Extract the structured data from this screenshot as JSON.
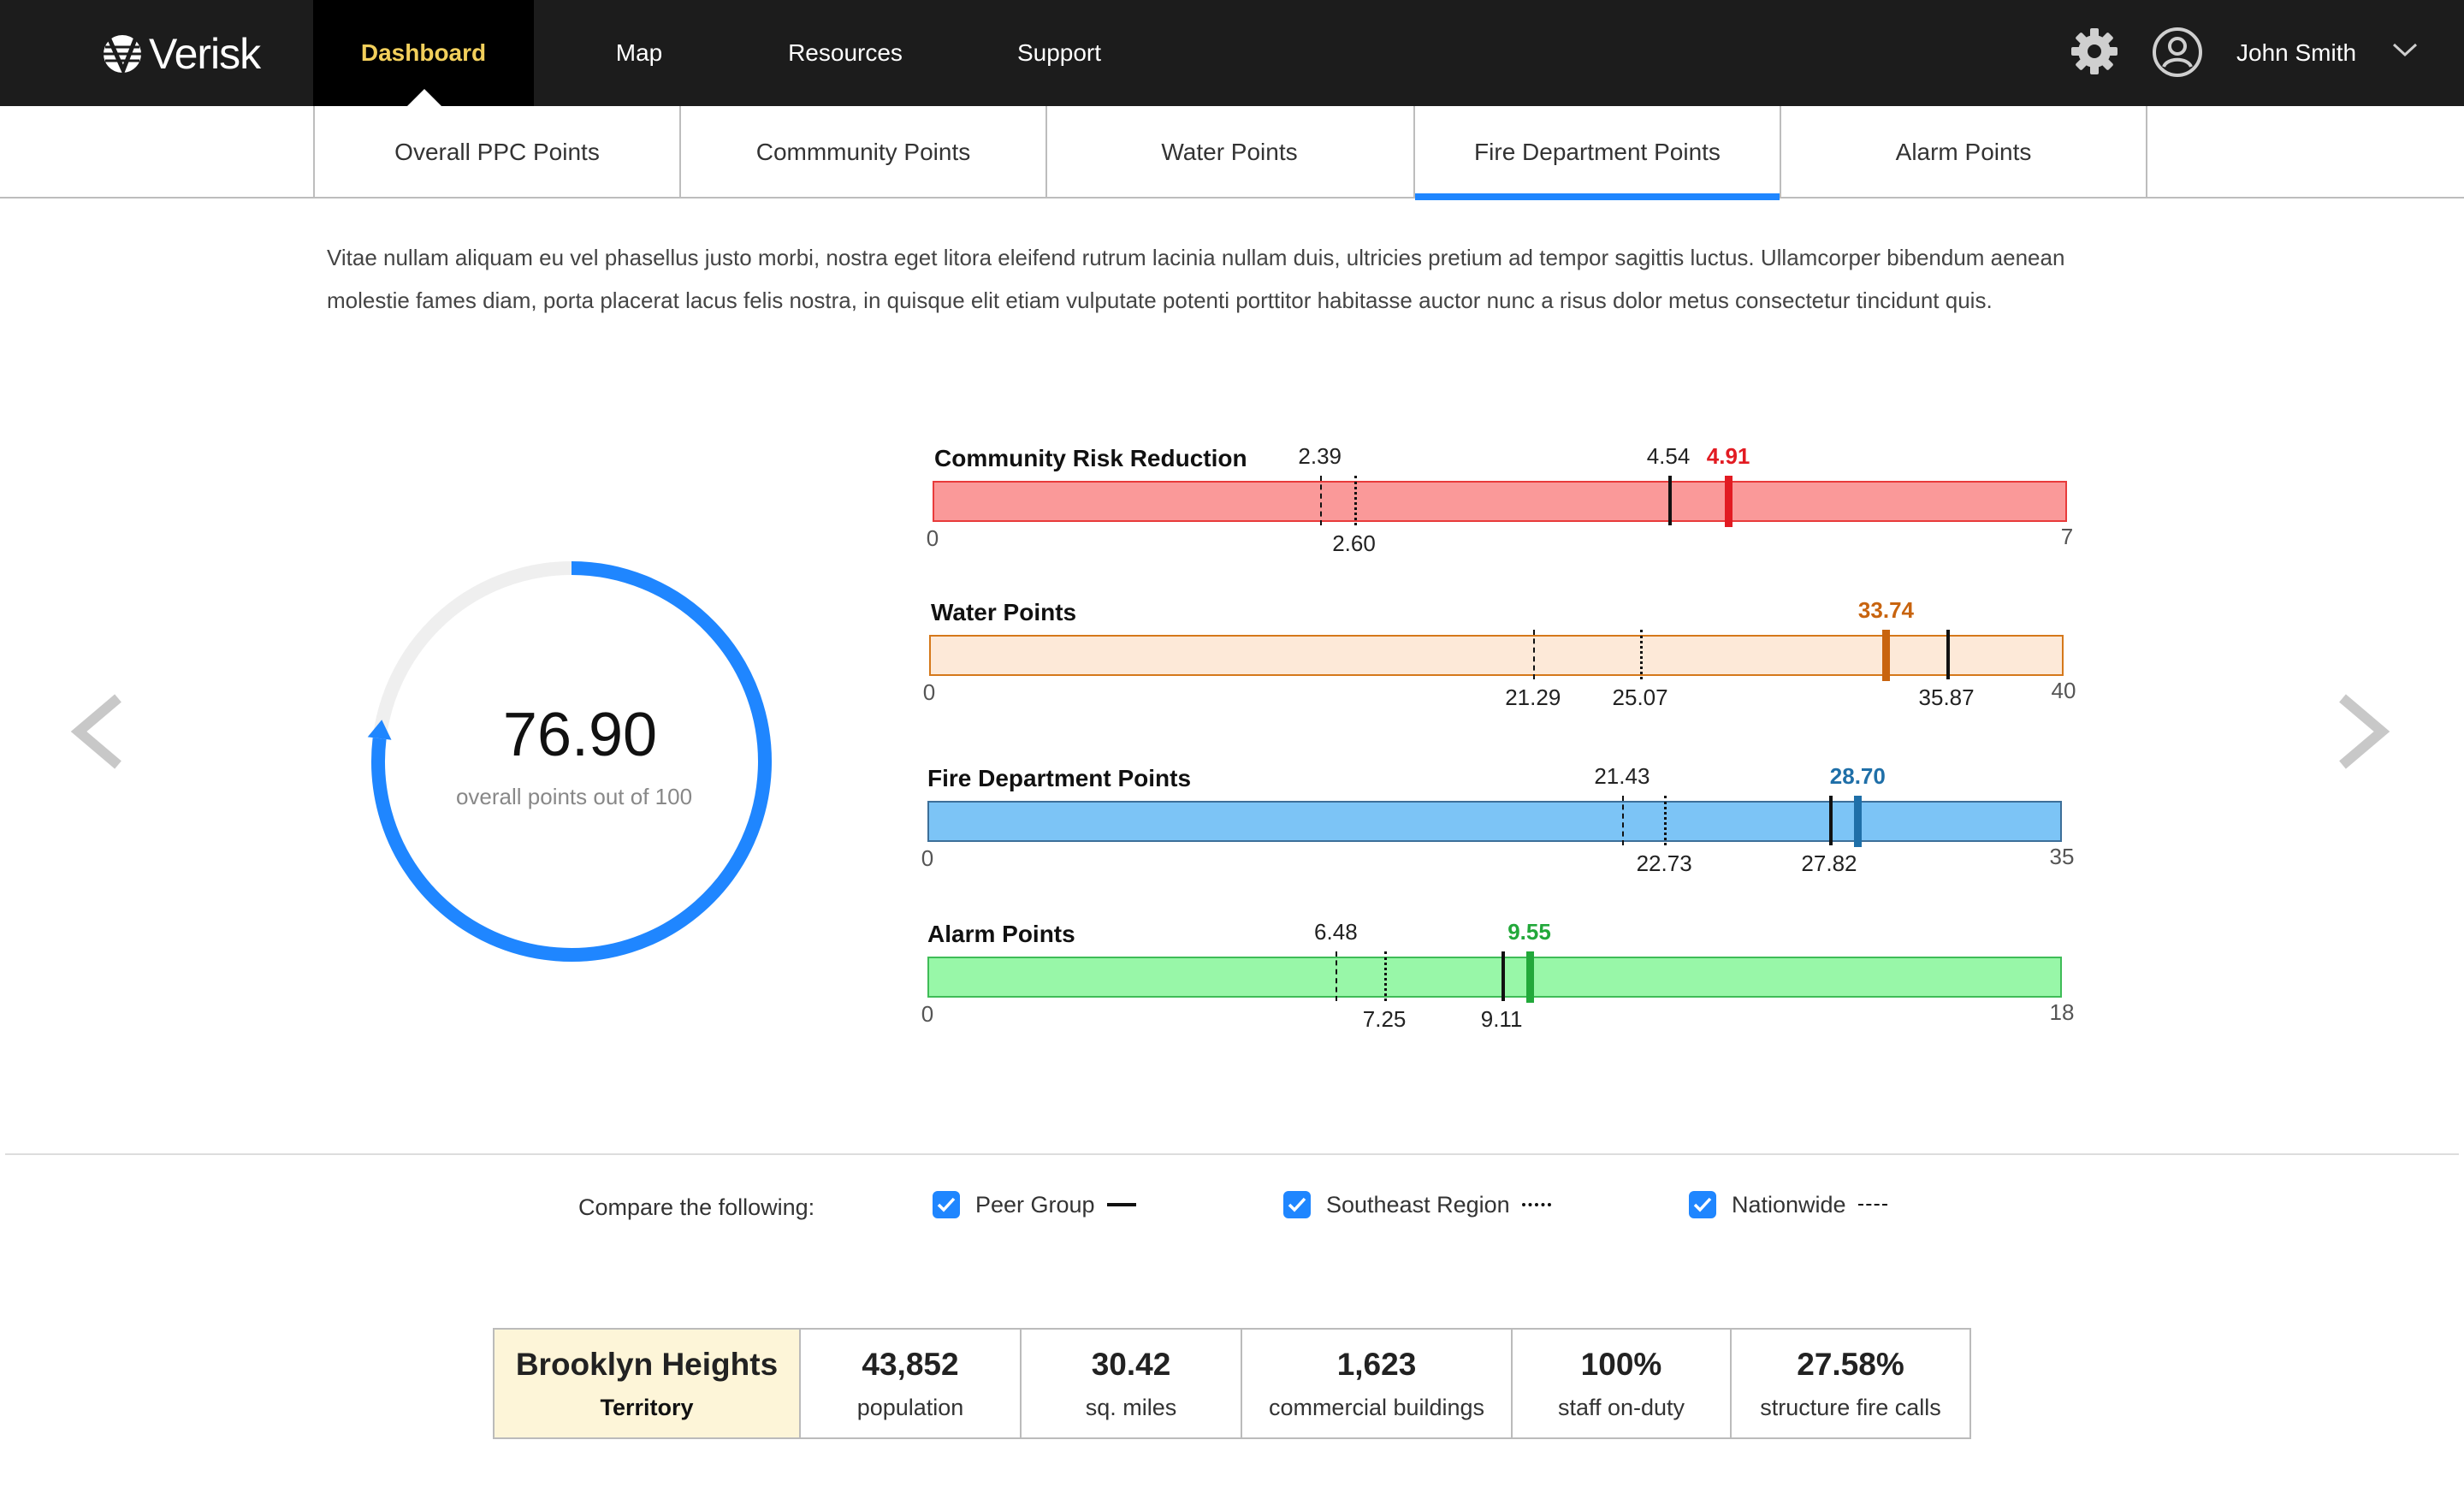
{
  "brand": {
    "name": "Verisk"
  },
  "nav": {
    "items": [
      {
        "label": "Dashboard",
        "active": true
      },
      {
        "label": "Map"
      },
      {
        "label": "Resources"
      },
      {
        "label": "Support"
      }
    ],
    "user": {
      "name": "John Smith"
    },
    "icons": {
      "settings": "gear-icon",
      "user": "user-circle-icon",
      "menu": "chevron-down-icon"
    },
    "active_color": "#f2cf5b"
  },
  "tabs": [
    {
      "label": "Overall PPC Points"
    },
    {
      "label": "Commmunity Points"
    },
    {
      "label": "Water Points"
    },
    {
      "label": "Fire Department Points",
      "active": true
    },
    {
      "label": "Alarm Points"
    }
  ],
  "description": "Vitae nullam aliquam eu vel phasellus justo morbi, nostra eget litora eleifend rutrum lacinia nullam duis, ultricies pretium ad tempor sagittis luctus.  Ullamcorper bibendum aenean molestie fames diam, porta placerat lacus felis nostra, in quisque elit etiam vulputate potenti porttitor habitasse auctor nunc a risus dolor metus consectetur tincidunt quis.",
  "gauge": {
    "value": "76.90",
    "caption": "overall points out of 100",
    "fraction": 0.769,
    "color": "#1f86ff"
  },
  "chart_data": {
    "type": "bar",
    "series": [
      {
        "name": "Community Risk Reduction",
        "min": 0,
        "max": 7,
        "value": 4.91,
        "peer_group": 4.54,
        "southeast_region": 2.6,
        "nationwide": 2.39,
        "labels": {
          "min": "0",
          "max": "7",
          "value": "4.91",
          "peer_group": "4.54",
          "southeast_region": "2.60",
          "nationwide": "2.39"
        },
        "fill": "#fa9999",
        "border": "#e83b3b",
        "accent": "#e21b22"
      },
      {
        "name": "Water Points",
        "min": 0,
        "max": 40,
        "value": 33.74,
        "peer_group": 35.87,
        "southeast_region": 25.07,
        "nationwide": 21.29,
        "labels": {
          "min": "0",
          "max": "40",
          "value": "33.74",
          "peer_group": "35.87",
          "southeast_region": "25.07",
          "nationwide": "21.29"
        },
        "fill": "#fde9d8",
        "border": "#d5781a",
        "accent": "#c8640f"
      },
      {
        "name": "Fire Department Points",
        "min": 0,
        "max": 35,
        "value": 28.7,
        "peer_group": 27.82,
        "southeast_region": 22.73,
        "nationwide": 21.43,
        "labels": {
          "min": "0",
          "max": "35",
          "value": "28.70",
          "peer_group": "27.82",
          "southeast_region": "22.73",
          "nationwide": "21.43"
        },
        "fill": "#7cc4f6",
        "border": "#3d6f99",
        "accent": "#1f6fa8"
      },
      {
        "name": "Alarm Points",
        "min": 0,
        "max": 18,
        "value": 9.55,
        "peer_group": 9.11,
        "southeast_region": 7.25,
        "nationwide": 6.48,
        "labels": {
          "min": "0",
          "max": "18",
          "value": "9.55",
          "peer_group": "9.11",
          "southeast_region": "7.25",
          "nationwide": "6.48"
        },
        "fill": "#98f7a8",
        "border": "#3fbc57",
        "accent": "#22a83a"
      }
    ]
  },
  "compare": {
    "label": "Compare the following:",
    "options": [
      {
        "label": "Peer Group",
        "checked": true,
        "line": "solid"
      },
      {
        "label": "Southeast Region",
        "checked": true,
        "line": "dotted"
      },
      {
        "label": "Nationwide",
        "checked": true,
        "line": "dashed"
      }
    ]
  },
  "stats": {
    "territory": {
      "name": "Brooklyn Heights",
      "type": "Territory"
    },
    "items": [
      {
        "value": "43,852",
        "label": "population"
      },
      {
        "value": "30.42",
        "label": "sq. miles"
      },
      {
        "value": "1,623",
        "label": "commercial buildings"
      },
      {
        "value": "100%",
        "label": "staff on-duty"
      },
      {
        "value": "27.58%",
        "label": "structure fire calls"
      }
    ]
  }
}
